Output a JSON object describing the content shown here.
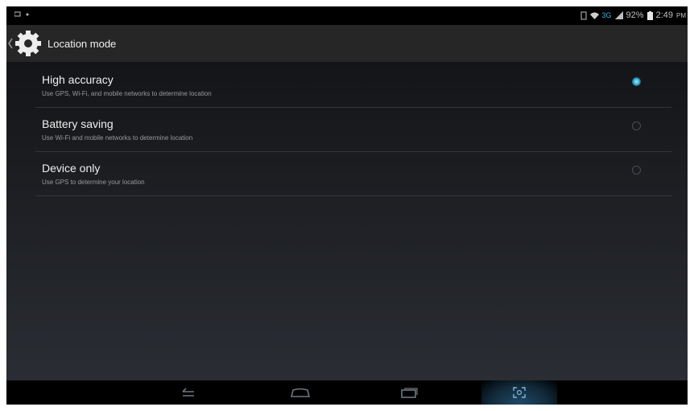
{
  "status_bar": {
    "battery_percent": "92%",
    "time": "2:49",
    "network": "3G"
  },
  "header": {
    "title": "Location mode",
    "icon": "gear-icon"
  },
  "options": [
    {
      "title": "High accuracy",
      "summary": "Use GPS, Wi-Fi, and mobile networks to determine location",
      "selected": true
    },
    {
      "title": "Battery saving",
      "summary": "Use Wi-Fi and mobile networks to determine location",
      "selected": false
    },
    {
      "title": "Device only",
      "summary": "Use GPS to determine your location",
      "selected": false
    }
  ],
  "colors": {
    "accent": "#33b5e5",
    "action_bar": "#262626"
  }
}
